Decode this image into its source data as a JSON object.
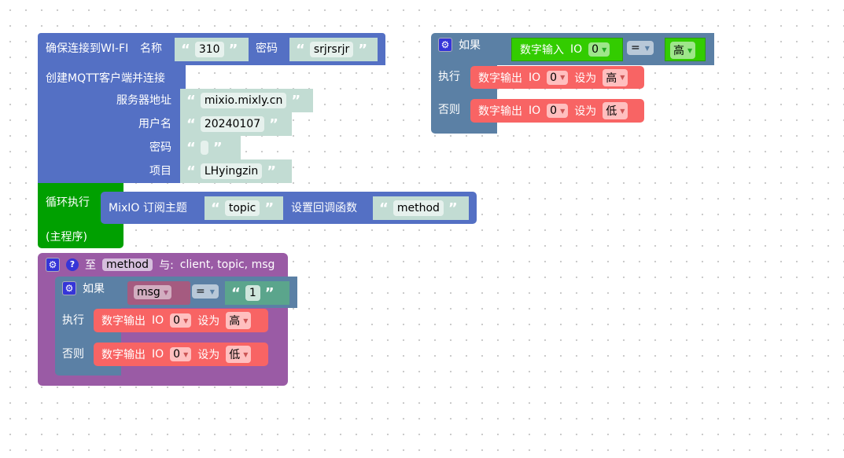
{
  "wifi": {
    "label": "确保连接到WI-FI",
    "name_label": "名称",
    "name": "310",
    "pwd_label": "密码",
    "pwd": "srjrsrjr"
  },
  "mqtt": {
    "label": "创建MQTT客户端并连接",
    "server_label": "服务器地址",
    "server": "mixio.mixly.cn",
    "user_label": "用户名",
    "user": "20240107",
    "pwd_label": "密码",
    "pwd": "",
    "project_label": "项目",
    "project": "LHyingzin"
  },
  "loop": {
    "label": "循环执行",
    "sub": "(主程序)"
  },
  "subscribe": {
    "label": "MixIO 订阅主题",
    "topic": "topic",
    "callback_label": "设置回调函数",
    "callback": "method"
  },
  "func": {
    "to": "至",
    "name": "method",
    "with": "与:",
    "params": "client, topic, msg",
    "help": "?",
    "if": {
      "label": "如果",
      "var": "msg",
      "op": "=",
      "value": "1",
      "then": "执行",
      "else": "否则",
      "then_action": {
        "label": "数字输出",
        "io": "IO",
        "pin": "0",
        "set": "设为",
        "level": "高"
      },
      "else_action": {
        "label": "数字输出",
        "io": "IO",
        "pin": "0",
        "set": "设为",
        "level": "低"
      }
    }
  },
  "if2": {
    "label": "如果",
    "cond": {
      "label": "数字输入",
      "io": "IO",
      "pin": "0",
      "op": "=",
      "level": "高"
    },
    "then": "执行",
    "else": "否则",
    "then_action": {
      "label": "数字输出",
      "io": "IO",
      "pin": "0",
      "set": "设为",
      "level": "高"
    },
    "else_action": {
      "label": "数字输出",
      "io": "IO",
      "pin": "0",
      "set": "设为",
      "level": "低"
    }
  },
  "quote_open": "“",
  "quote_close": "”",
  "colors": {
    "mqtt": "#5470c4",
    "loop": "#00a000",
    "procedure": "#9a5ba5",
    "logic": "#5b80a5",
    "io_out": "#f86464",
    "io_in": "#33cc00",
    "text": "#c2dcd3"
  }
}
